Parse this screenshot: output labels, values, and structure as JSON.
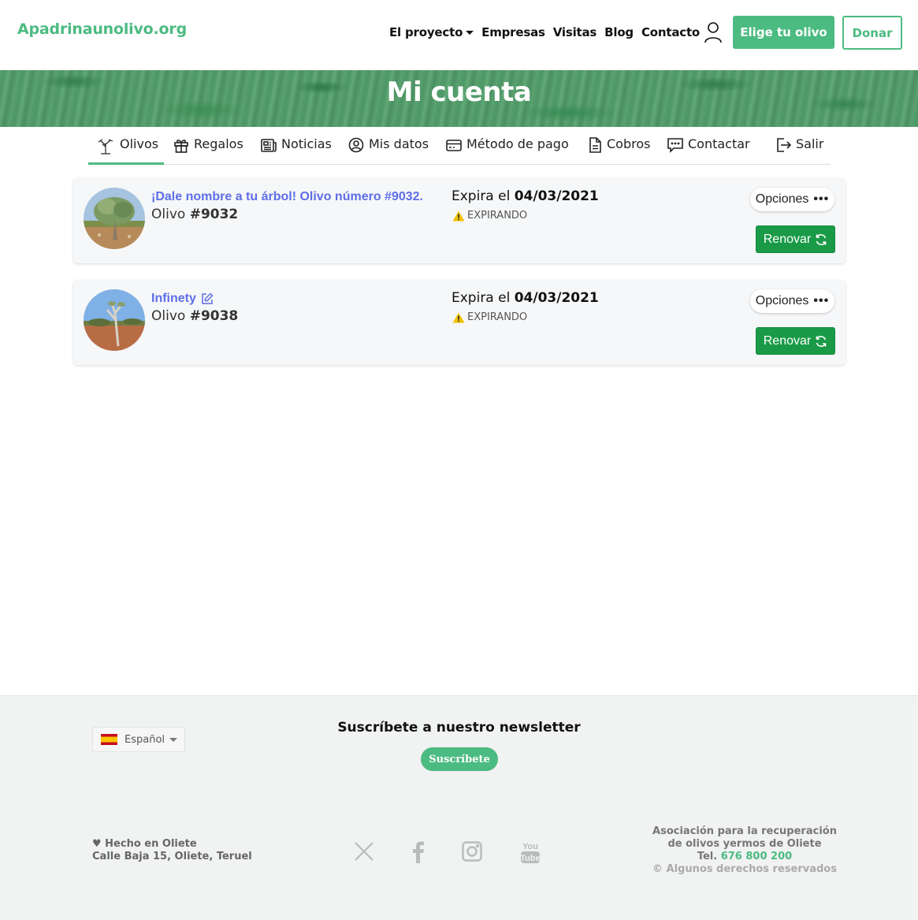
{
  "header": {
    "logo": "Apadrinaunolivo.org",
    "nav": [
      {
        "label": "El proyecto",
        "dropdown": true
      },
      {
        "label": "Empresas"
      },
      {
        "label": "Visitas"
      },
      {
        "label": "Blog"
      },
      {
        "label": "Contacto"
      }
    ],
    "user_icon": "user-icon",
    "cta_label": "Elige tu olivo",
    "donate_label": "Donar"
  },
  "banner": {
    "title": "Mi cuenta"
  },
  "tabs": [
    {
      "label": "Olivos",
      "icon": "tree-icon",
      "active": true
    },
    {
      "label": "Regalos",
      "icon": "gift-icon"
    },
    {
      "label": "Noticias",
      "icon": "newspaper-icon"
    },
    {
      "label": "Mis datos",
      "icon": "user-circle-icon"
    },
    {
      "label": "Método de pago",
      "icon": "credit-card-icon"
    },
    {
      "label": "Cobros",
      "icon": "document-icon"
    },
    {
      "label": "Contactar",
      "icon": "chat-icon"
    },
    {
      "label": "Salir",
      "icon": "logout-icon"
    }
  ],
  "trees": [
    {
      "name": "¡Dale nombre a tu árbol! Olivo número #9032.",
      "number_prefix": "Olivo ",
      "number": "#9032",
      "expires_prefix": "Expira el ",
      "expires_date": "04/03/2021",
      "status": "EXPIRANDO",
      "options_label": "Opciones",
      "renew_label": "Renovar"
    },
    {
      "name": "Infinety",
      "number_prefix": "Olivo ",
      "number": "#9038",
      "expires_prefix": "Expira el ",
      "expires_date": "04/03/2021",
      "status": "EXPIRANDO",
      "options_label": "Opciones",
      "renew_label": "Renovar"
    }
  ],
  "footer": {
    "language": "Español",
    "newsletter_title": "Suscríbete a nuestro newsletter",
    "subscribe_label": "Suscríbete",
    "made_in": "♥ Hecho en Oliete",
    "address": "Calle Baja 15, Oliete, Teruel",
    "socials": [
      "x-icon",
      "facebook-icon",
      "instagram-icon",
      "youtube-icon"
    ],
    "assoc_line1": "Asociación para la recuperación",
    "assoc_line2": "de olivos yermos de Oliete",
    "tel_prefix": "Tel. ",
    "tel_number": "676 800 200",
    "rights": "© Algunos derechos reservados"
  },
  "colors": {
    "brand": "#4cbb81",
    "renew": "#1a9a47",
    "link": "#5d6ee6",
    "warning": "#f2c200"
  }
}
